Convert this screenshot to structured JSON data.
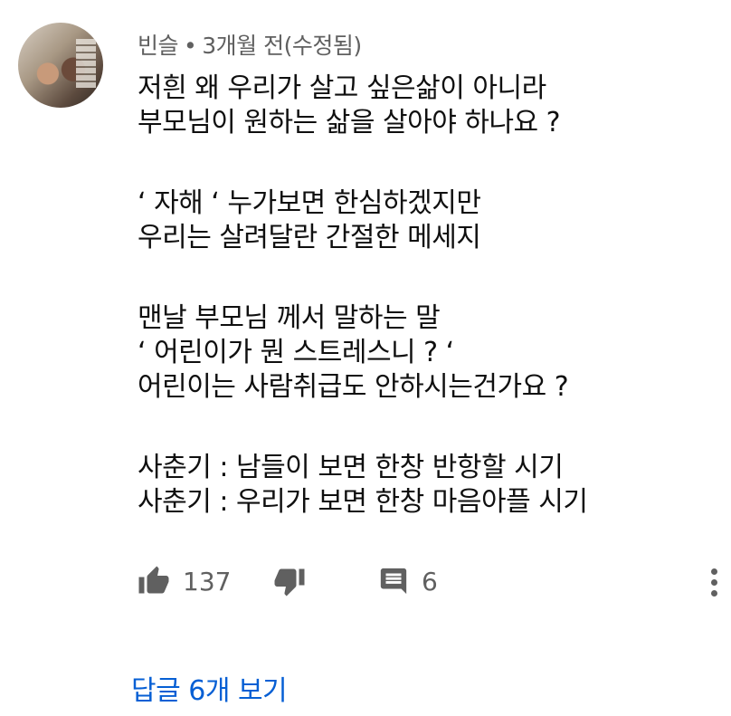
{
  "comment": {
    "author": "빈슬",
    "separator": "•",
    "timestamp": "3개월 전(수정됨)",
    "lines": [
      "저흰 왜 우리가 살고 싶은삶이 아니라",
      "부모님이 원하는 삶을 살아야 하나요 ?",
      "",
      "‘ 자해 ‘ 누가보면 한심하겠지만",
      "우리는 살려달란 간절한 메세지",
      "",
      "맨날 부모님 께서 말하는 말",
      "‘ 어린이가 뭔 스트레스니 ? ‘",
      "어린이는 사람취급도 안하시는건가요 ?",
      "",
      "사춘기 : 남들이 보면 한창 반항할 시기",
      "사춘기 : 우리가 보면 한창 마음아플 시기"
    ],
    "like_count": "137",
    "reply_count": "6",
    "view_replies_label": "답글 6개 보기"
  },
  "icons": {
    "like": "thumbs-up-icon",
    "dislike": "thumbs-down-icon",
    "reply": "comment-icon",
    "more": "more-vert-icon"
  },
  "colors": {
    "text": "#0f0f0f",
    "secondary": "#606060",
    "link": "#065fd4"
  }
}
